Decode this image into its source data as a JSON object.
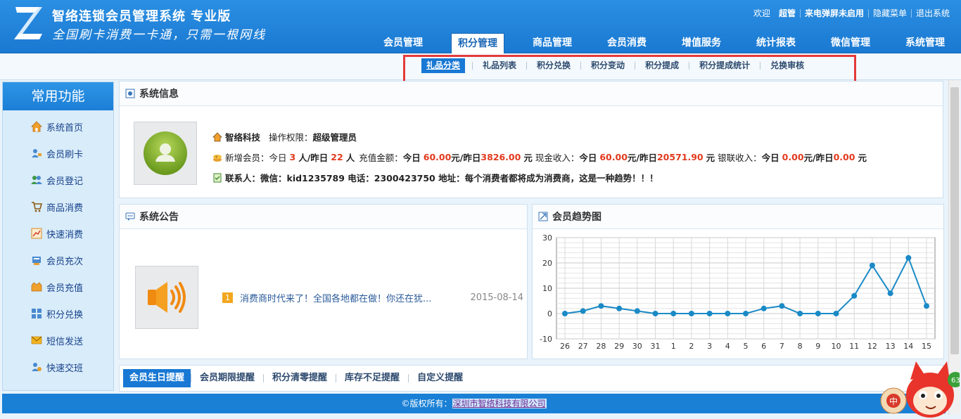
{
  "header": {
    "title": "智络连锁会员管理系统 专业版",
    "slogan": "全国刷卡消费一卡通，只需一根网线",
    "welcome": "欢迎",
    "user": "超管",
    "popup_status": "来电弹屏未启用",
    "hide_menu": "隐藏菜单",
    "logout": "退出系统"
  },
  "main_nav": [
    {
      "label": "会员管理",
      "icon": "none"
    },
    {
      "label": "积分管理",
      "active": true
    },
    {
      "label": "商品管理"
    },
    {
      "label": "会员消费"
    },
    {
      "label": "增值服务"
    },
    {
      "label": "统计报表"
    },
    {
      "label": "微信管理"
    },
    {
      "label": "系统管理"
    }
  ],
  "sub_nav": [
    "礼品分类",
    "礼品列表",
    "积分兑换",
    "积分变动",
    "积分提成",
    "积分提成统计",
    "兑换审核"
  ],
  "sidebar": {
    "title": "常用功能",
    "items": [
      {
        "label": "系统首页",
        "icon": "home-icon"
      },
      {
        "label": "会员刷卡",
        "icon": "member-card-icon"
      },
      {
        "label": "会员登记",
        "icon": "register-icon"
      },
      {
        "label": "商品消费",
        "icon": "cart-icon"
      },
      {
        "label": "快速消费",
        "icon": "chart-icon"
      },
      {
        "label": "会员充次",
        "icon": "recharge-count-icon"
      },
      {
        "label": "会员充值",
        "icon": "recharge-icon"
      },
      {
        "label": "积分兑换",
        "icon": "gift-icon"
      },
      {
        "label": "短信发送",
        "icon": "mail-icon"
      },
      {
        "label": "快速交班",
        "icon": "handover-icon"
      }
    ]
  },
  "system_info": {
    "title": "系统信息",
    "company": "智络科技",
    "permission_label": "操作权限：",
    "permission": "超级管理员",
    "new_members_label": "新增会员：今日",
    "new_today": "3",
    "unit_person_yesterday": "人/昨日",
    "new_yesterday": "22",
    "unit_person": "人",
    "recharge_label": "充值金额：",
    "today_word": "今日",
    "recharge_today": "60.00",
    "unit_yuan_yesterday": "元/昨日",
    "recharge_yesterday": "3826.00",
    "unit_yuan": "元",
    "cash_label": "现金收入：",
    "cash_today": "60.00",
    "cash_yesterday": "20571.90",
    "union_label": "银联收入：",
    "union_today": "0.00",
    "union_yesterday": "0.00",
    "contact_line": "联系人：微信：kid1235789  电话：2300423750  地址：每个消费者都将成为消费商，这是一种趋势！！！"
  },
  "notice": {
    "title": "系统公告",
    "items": [
      {
        "num": "1",
        "text": "消费商时代来了！全国各地都在做！你还在犹...",
        "date": "2015-08-14"
      }
    ]
  },
  "trend": {
    "title": "会员趋势图"
  },
  "chart_data": {
    "type": "line",
    "x": [
      "26",
      "27",
      "28",
      "29",
      "30",
      "31",
      "1",
      "2",
      "3",
      "4",
      "5",
      "6",
      "7",
      "8",
      "9",
      "10",
      "11",
      "12",
      "13",
      "14",
      "15"
    ],
    "series": [
      {
        "values": [
          0,
          1,
          3,
          2,
          1,
          0,
          0,
          0,
          0,
          0,
          0,
          2,
          3,
          0,
          0,
          0,
          7,
          19,
          8,
          22,
          3
        ]
      }
    ],
    "ylim": [
      -10,
      30
    ],
    "yticks": [
      -10,
      0,
      10,
      20,
      30
    ],
    "grid": true,
    "color": "#1a8ac6"
  },
  "reminders": [
    "会员生日提醒",
    "会员期限提醒",
    "积分清零提醒",
    "库存不足提醒",
    "自定义提醒"
  ],
  "footer": {
    "copyright": "©版权所有：",
    "company_link": "深圳市智络科技有限公司"
  },
  "colors": {
    "header_blue": "#1a79d2",
    "highlight_red": "#e43a3a",
    "value_red": "#e23a1e"
  }
}
